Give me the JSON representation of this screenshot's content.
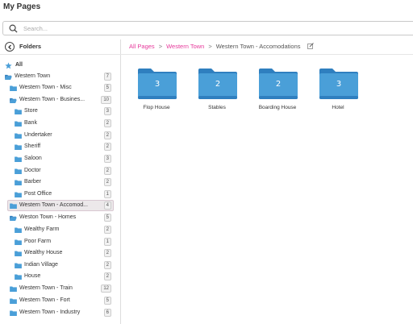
{
  "app": {
    "title": "My Pages"
  },
  "search": {
    "placeholder": "Search..."
  },
  "sidebar": {
    "header": "Folders",
    "all_label": "All",
    "items": [
      {
        "label": "Western Town",
        "count": "7"
      },
      {
        "label": "Western Town - Misc",
        "count": "5"
      },
      {
        "label": "Western Town - Busines...",
        "count": "10"
      },
      {
        "label": "Store",
        "count": "3"
      },
      {
        "label": "Bank",
        "count": "2"
      },
      {
        "label": "Undertaker",
        "count": "2"
      },
      {
        "label": "Sheriff",
        "count": "2"
      },
      {
        "label": "Saloon",
        "count": "3"
      },
      {
        "label": "Doctor",
        "count": "2"
      },
      {
        "label": "Barber",
        "count": "2"
      },
      {
        "label": "Post Office",
        "count": "1"
      },
      {
        "label": "Western Town - Accomod...",
        "count": "4"
      },
      {
        "label": "Weston Town - Homes",
        "count": "5"
      },
      {
        "label": "Wealthy Farm",
        "count": "2"
      },
      {
        "label": "Poor Farm",
        "count": "1"
      },
      {
        "label": "Wealthy House",
        "count": "2"
      },
      {
        "label": "Indian Village",
        "count": "2"
      },
      {
        "label": "House",
        "count": "2"
      },
      {
        "label": "Western Town - Train",
        "count": "12"
      },
      {
        "label": "Western Town - Fort",
        "count": "5"
      },
      {
        "label": "Western Town - Industry",
        "count": "6"
      }
    ]
  },
  "breadcrumb": {
    "root": "All Pages",
    "parent": "Western Town",
    "current": "Western Town - Accomodations"
  },
  "folders": [
    {
      "name": "Flop House",
      "count": "3"
    },
    {
      "name": "Stables",
      "count": "2"
    },
    {
      "name": "Boarding House",
      "count": "2"
    },
    {
      "name": "Hotel",
      "count": "3"
    }
  ],
  "colors": {
    "accent": "#e6399b",
    "folder": "#4a9fd8",
    "folder_dark": "#2f7fbf",
    "star": "#4a9fd8"
  }
}
